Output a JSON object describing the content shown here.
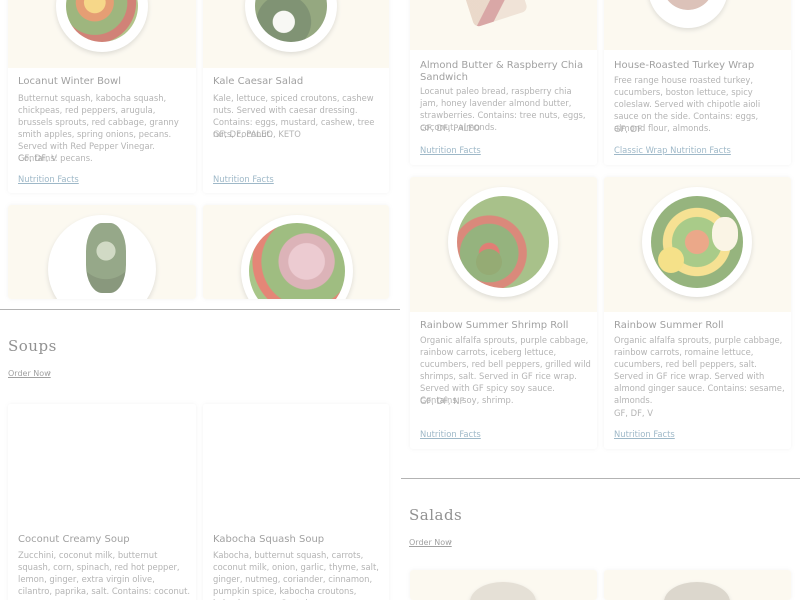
{
  "left": {
    "top_cards": [
      {
        "title": "Locanut Winter Bowl",
        "description": "Butternut squash, kabocha squash, chickpeas, red peppers, arugula, brussels sprouts, red cabbage, granny smith apples, spring onions, pecans. Served with Red Pepper Vinegar. Contains: pecans.",
        "tags": "GF, DF, V",
        "link": "Nutrition Facts"
      },
      {
        "title": "Kale Caesar Salad",
        "description": "Kale, lettuce, spiced croutons, cashew nuts. Served with caesar dressing. Contains: eggs, mustard, cashew, tree nuts, coconut.",
        "tags": "GF, DF, PALEO, KETO",
        "link": "Nutrition Facts"
      }
    ],
    "soups": {
      "title": "Soups",
      "order_now": "Order Now",
      "cards": [
        {
          "title": "Coconut Creamy Soup",
          "description": "Zucchini, coconut milk, butternut squash, corn, spinach, red hot pepper, lemon, ginger, extra virgin olive, cilantro, paprika, salt. Contains: coconut."
        },
        {
          "title": "Kabocha Squash Soup",
          "description": "Kabocha, butternut squash, carrots, coconut milk, onion, garlic, thyme, salt, ginger, nutmeg, coriander, cinnamon, pumpkin spice, kabocha croutons, kabocha puree. Contains:"
        }
      ]
    }
  },
  "right": {
    "top_cards": [
      {
        "title": "Almond Butter & Raspberry Chia Sandwich",
        "description": "Locanut paleo bread, raspberry chia jam, honey lavender almond butter, strawberries. Contains: tree nuts, eggs, coconut, almonds.",
        "tags": "GF, DF, PALEO",
        "link": "Nutrition Facts"
      },
      {
        "title": "House-Roasted Turkey Wrap",
        "description": "Free range house roasted turkey, cucumbers, boston lettuce, spicy coleslaw. Served with chipotle aioli sauce on the side. Contains: eggs, almond flour, almonds.",
        "tags": "GF, DF",
        "link": "Classic Wrap Nutrition Facts"
      }
    ],
    "mid_cards": [
      {
        "title": "Rainbow Summer Shrimp Roll",
        "description": "Organic alfalfa sprouts, purple cabbage, rainbow carrots, iceberg lettuce, cucumbers, red bell peppers, grilled wild shrimps, salt. Served in GF rice wrap. Served with GF spicy soy sauce. Contains: soy, shrimp.",
        "tags": "GF, DF, NF",
        "link": "Nutrition Facts"
      },
      {
        "title": "Rainbow Summer Roll",
        "description": "Organic alfalfa sprouts, purple cabbage, rainbow carrots, romaine lettuce, cucumbers, red bell peppers, salt. Served in GF rice wrap. Served with almond ginger sauce. Contains: sesame, almonds.",
        "tags": "GF, DF, V",
        "link": "Nutrition Facts"
      }
    ],
    "salads": {
      "title": "Salads",
      "order_now": "Order Now"
    }
  },
  "colors": {
    "card_image_bg": "#faf6e9",
    "link": "#3a6f8f",
    "divider": "#8a8a8a"
  }
}
